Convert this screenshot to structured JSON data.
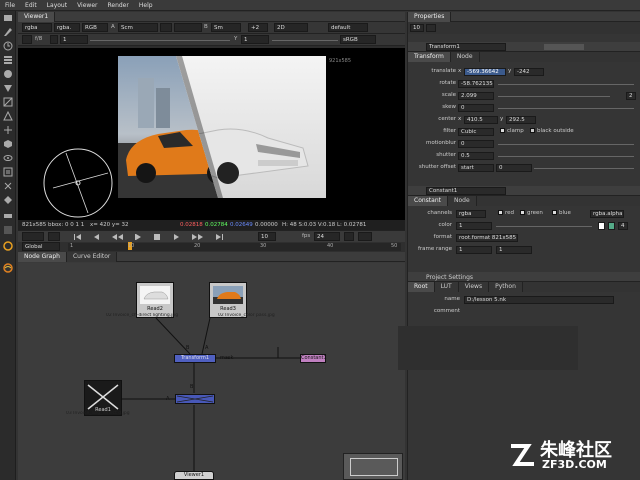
{
  "menu": [
    "File",
    "Edit",
    "Layout",
    "Viewer",
    "Render",
    "Help"
  ],
  "viewer": {
    "tab": "Viewer1",
    "ctrl1": {
      "channel": "rgba",
      "layer": "rgba.",
      "space": "RGB",
      "a_label": "A",
      "a_input": "Scm",
      "b_label": "B",
      "b_input": "Sm",
      "zoom": "+2",
      "mode": "2D",
      "lut": "default"
    },
    "ctrl2": {
      "fstop": "f/8",
      "frame": "1",
      "y_label": "Y",
      "y_val": "1",
      "display": "sRGB"
    },
    "format": "921x585",
    "info": {
      "size": "821x585 bbox: 0 0 1 1",
      "coords": "x= 420 y= 32",
      "r": "0.02818",
      "g": "0.02784",
      "b": "0.02649",
      "a": "0.00000",
      "hsvl": "H: 48 S:0.03 V:0.18  L: 0.02781"
    },
    "fps_label": "fps",
    "fps": "24",
    "step": "10",
    "range": "Global",
    "timeline_ticks": [
      "1",
      "10",
      "20",
      "30",
      "40",
      "50"
    ]
  },
  "nodegraph": {
    "tabs": [
      "Node Graph",
      "Curve Editor"
    ],
    "nodes": {
      "read2": {
        "name": "Read2",
        "file": "02 Invoice_ch-direct lighting.jpg"
      },
      "read3": {
        "name": "Read3",
        "file": "02 Invoice_color pass.jpg"
      },
      "read1": {
        "name": "Read1",
        "file": "03 Invoice_ring_reflect d.jpg"
      },
      "transform1": {
        "name": "Transform1"
      },
      "constant1": {
        "name": "Constant1"
      },
      "viewer1": {
        "name": "Viewer1"
      }
    },
    "labels": {
      "b1": "B",
      "a1": "A",
      "mask": "mask",
      "b2": "B",
      "a2": "A"
    }
  },
  "properties": {
    "tab": "Properties",
    "count": "10",
    "transform": {
      "name": "Transform1",
      "tabs": [
        "Transform",
        "Node"
      ],
      "translate": {
        "label": "translate",
        "x_label": "x",
        "x": "-569.36642",
        "y_label": "y",
        "y": "-242"
      },
      "rotate": {
        "label": "rotate",
        "val": "-58.762135"
      },
      "scale": {
        "label": "scale",
        "val": "2.099",
        "btn": "2"
      },
      "skew": {
        "label": "skew",
        "val": "0"
      },
      "center": {
        "label": "center",
        "x_label": "x",
        "x": "410.5",
        "y_label": "y",
        "y": "292.5"
      },
      "filter": {
        "label": "filter",
        "val": "Cubic",
        "clamp": "clamp",
        "black": "black outside"
      },
      "motionblur": {
        "label": "motionblur",
        "val": "0"
      },
      "shutter": {
        "label": "shutter",
        "val": "0.5"
      },
      "shutter_offset": {
        "label": "shutter offset",
        "val": "start",
        "val2": "0"
      }
    },
    "constant": {
      "name": "Constant1",
      "tabs": [
        "Constant",
        "Node"
      ],
      "channels": {
        "label": "channels",
        "val": "rgba",
        "red": "red",
        "green": "green",
        "blue": "blue",
        "alpha": "rgba.alpha"
      },
      "color": {
        "label": "color",
        "val": "1",
        "btn": "4"
      },
      "format": {
        "label": "format",
        "val": "root.format 821x585"
      },
      "frame_range": {
        "label": "frame range",
        "a": "1",
        "b": "1"
      }
    },
    "project": {
      "title": "Project Settings",
      "tabs": [
        "Root",
        "LUT",
        "Views",
        "Python"
      ],
      "name": {
        "label": "name",
        "val": "D:/lesson 5.nk"
      },
      "comment": {
        "label": "comment"
      }
    }
  },
  "watermark": {
    "cn": "朱峰社区",
    "url": "ZF3D.COM"
  },
  "colors": {
    "accent": "#3b5a8c",
    "node_read": "#c8c8c8",
    "node_transform": "#5060c0",
    "node_constant": "#c080c0",
    "car_orange": "#e07a1a"
  }
}
